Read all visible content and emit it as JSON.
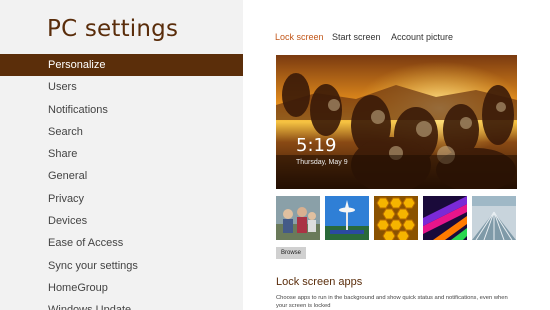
{
  "left": {
    "title": "PC settings",
    "nav": [
      {
        "label": "Personalize",
        "selected": true
      },
      {
        "label": "Users"
      },
      {
        "label": "Notifications"
      },
      {
        "label": "Search"
      },
      {
        "label": "Share"
      },
      {
        "label": "General"
      },
      {
        "label": "Privacy"
      },
      {
        "label": "Devices"
      },
      {
        "label": "Ease of Access"
      },
      {
        "label": "Sync your settings"
      },
      {
        "label": "HomeGroup"
      },
      {
        "label": "Windows Update"
      }
    ]
  },
  "tabs": [
    {
      "label": "Lock screen",
      "active": true
    },
    {
      "label": "Start screen"
    },
    {
      "label": "Account picture"
    }
  ],
  "preview": {
    "time": "5:19",
    "date": "Thursday, May 9"
  },
  "thumbnails": [
    {
      "name": "people-photo"
    },
    {
      "name": "space-needle-photo"
    },
    {
      "name": "honeycomb-photo"
    },
    {
      "name": "color-stripes-photo"
    },
    {
      "name": "architecture-photo"
    }
  ],
  "browse_label": "Browse",
  "lock_screen_apps": {
    "heading": "Lock screen apps",
    "description": "Choose apps to run in the background and show quick status and notifications, even when your screen is locked"
  },
  "colors": {
    "accent": "#5b2e0a",
    "active_tab": "#c2571a",
    "sidebar_bg": "#f2f2f2"
  }
}
